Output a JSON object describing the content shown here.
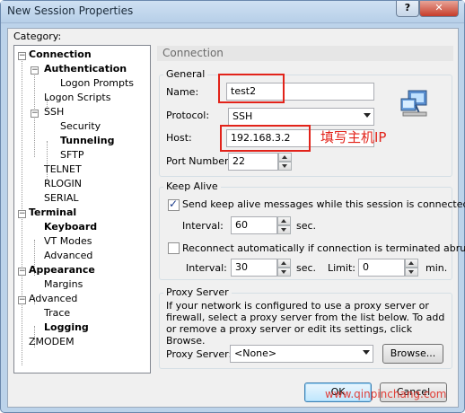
{
  "window": {
    "title": "New Session Properties",
    "help_label": "?",
    "close_label": "✕"
  },
  "category": {
    "label": "Category:",
    "items": [
      {
        "label": "Connection"
      },
      {
        "label": "Authentication"
      },
      {
        "label": "Logon Prompts"
      },
      {
        "label": "Logon Scripts"
      },
      {
        "label": "SSH"
      },
      {
        "label": "Security"
      },
      {
        "label": "Tunneling"
      },
      {
        "label": "SFTP"
      },
      {
        "label": "TELNET"
      },
      {
        "label": "RLOGIN"
      },
      {
        "label": "SERIAL"
      },
      {
        "label": "Terminal"
      },
      {
        "label": "Keyboard"
      },
      {
        "label": "VT Modes"
      },
      {
        "label": "Advanced"
      },
      {
        "label": "Appearance"
      },
      {
        "label": "Margins"
      },
      {
        "label": "Advanced"
      },
      {
        "label": "Trace"
      },
      {
        "label": "Logging"
      },
      {
        "label": "ZMODEM"
      }
    ]
  },
  "panel": {
    "header": "Connection"
  },
  "general": {
    "title": "General",
    "name_label": "Name:",
    "name_value": "test2",
    "protocol_label": "Protocol:",
    "protocol_value": "SSH",
    "host_label": "Host:",
    "host_value": "192.168.3.2",
    "port_label": "Port Number:",
    "port_value": "22",
    "annotation": "填写主机IP"
  },
  "keepalive": {
    "title": "Keep Alive",
    "send_label": "Send keep alive messages while this session is connected",
    "send_checked": true,
    "interval_label": "Interval:",
    "interval_value": "60",
    "sec_label": "sec.",
    "reconnect_label": "Reconnect automatically if connection is terminated abruptly",
    "reconnect_checked": false,
    "reinterval_label": "Interval:",
    "reinterval_value": "30",
    "resec_label": "sec.",
    "limit_label": "Limit:",
    "limit_value": "0",
    "min_label": "min."
  },
  "proxy": {
    "title": "Proxy Server",
    "description": "If your network is configured to use a proxy server or firewall, select a proxy server from the list below. To add or remove a proxy server or edit its settings, click Browse.",
    "server_label": "Proxy Server:",
    "server_value": "<None>",
    "browse_label": "Browse..."
  },
  "buttons": {
    "ok_label": "OK",
    "cancel_label": "Cancel"
  },
  "watermark": "www.qinpinchang.com",
  "colors": {
    "accent": "#3c7fb1",
    "annotation": "#e2231a"
  }
}
